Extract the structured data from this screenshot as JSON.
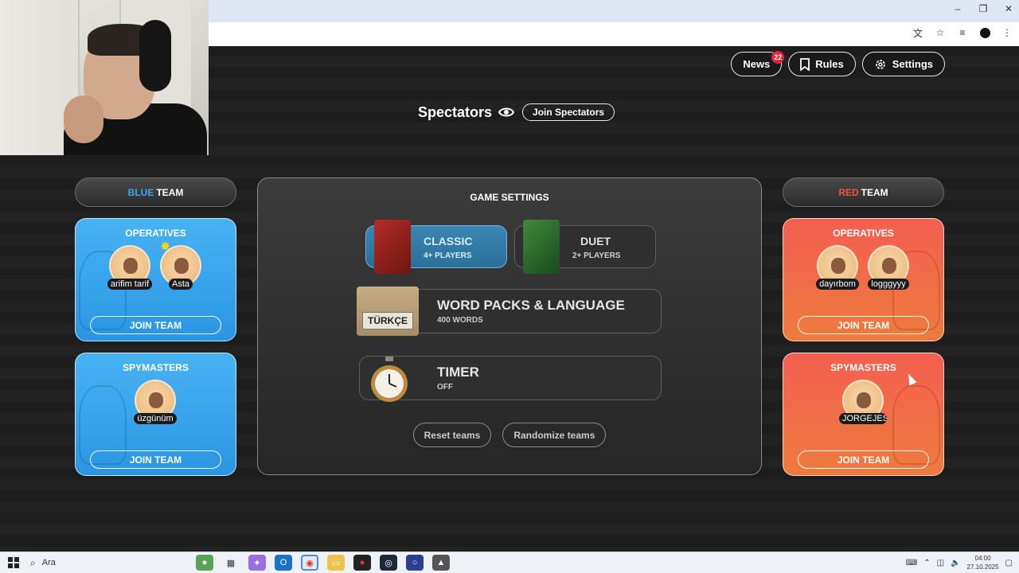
{
  "window_controls": [
    "–",
    "❐",
    "✕"
  ],
  "nav": {
    "news": "News",
    "news_badge": "22",
    "rules": "Rules",
    "settings": "Settings"
  },
  "spectators": {
    "title": "Spectators",
    "join": "Join Spectators"
  },
  "blue_team": {
    "header_color_word": "BLUE",
    "header_rest": "TEAM",
    "operatives": {
      "title": "OPERATIVES",
      "players": [
        "arifim tarif",
        "Asta"
      ],
      "join": "JOIN TEAM"
    },
    "spymasters": {
      "title": "SPYMASTERS",
      "players": [
        "üzgünüm"
      ],
      "join": "JOIN TEAM"
    }
  },
  "red_team": {
    "header_color_word": "RED",
    "header_rest": "TEAM",
    "operatives": {
      "title": "OPERATIVES",
      "players": [
        "dayırbom",
        "logggyyy"
      ],
      "join": "JOIN TEAM"
    },
    "spymasters": {
      "title": "SPYMASTERS",
      "players": [
        "JORGEJES"
      ],
      "join": "JOIN TEAM"
    }
  },
  "game_settings": {
    "title": "GAME SETTINGS",
    "modes": [
      {
        "label": "CLASSIC",
        "sub": "4+ PLAYERS",
        "active": true
      },
      {
        "label": "DUET",
        "sub": "2+ PLAYERS",
        "active": false
      }
    ],
    "word_packs": {
      "label": "WORD PACKS & LANGUAGE",
      "sub": "400 WORDS",
      "sign": "TÜRKÇE"
    },
    "timer": {
      "label": "TIMER",
      "sub": "OFF"
    },
    "reset": "Reset teams",
    "randomize": "Randomize teams"
  },
  "taskbar": {
    "search_placeholder": "Ara",
    "time": "04:00",
    "date": "27.10.2025"
  },
  "colors": {
    "blue_accent": "#3aa8ee",
    "red_accent": "#f2553f",
    "badge": "#e0243a"
  }
}
